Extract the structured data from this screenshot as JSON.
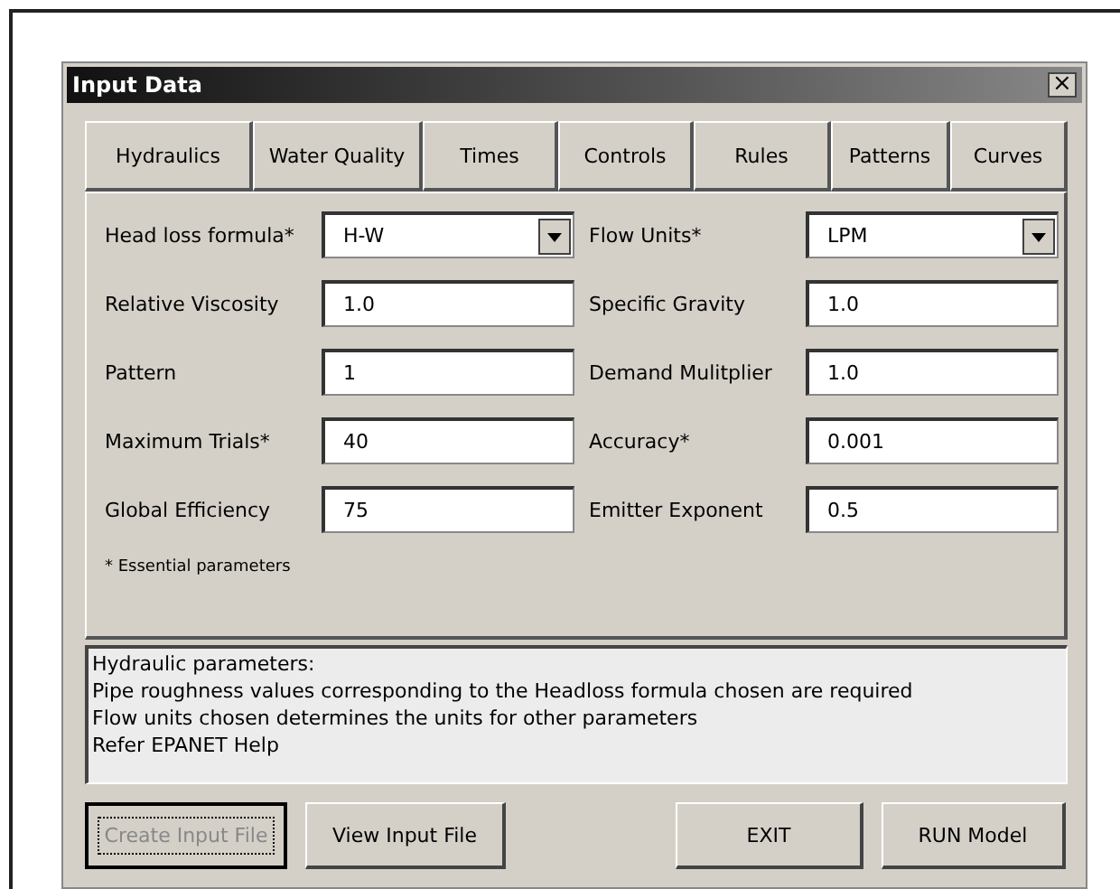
{
  "window": {
    "title": "Input Data",
    "close": "×"
  },
  "tabs": [
    {
      "label": "Hydraulics"
    },
    {
      "label": "Water Quality"
    },
    {
      "label": "Times"
    },
    {
      "label": "Controls"
    },
    {
      "label": "Rules"
    },
    {
      "label": "Patterns"
    },
    {
      "label": "Curves"
    }
  ],
  "fields": [
    {
      "label": "Head loss formula*",
      "value": "H-W",
      "kind": "dropdown"
    },
    {
      "label": "Flow Units*",
      "value": "LPM",
      "kind": "dropdown"
    },
    {
      "label": "Relative Viscosity",
      "value": "1.0",
      "kind": "text"
    },
    {
      "label": "Specific Gravity",
      "value": "1.0",
      "kind": "text"
    },
    {
      "label": "Pattern",
      "value": "1",
      "kind": "text"
    },
    {
      "label": "Demand Mulitplier",
      "value": "1.0",
      "kind": "text"
    },
    {
      "label": "Maximum Trials*",
      "value": "40",
      "kind": "text"
    },
    {
      "label": "Accuracy*",
      "value": "0.001",
      "kind": "text"
    },
    {
      "label": "Global Efficiency",
      "value": "75",
      "kind": "text"
    },
    {
      "label": "Emitter Exponent",
      "value": "0.5",
      "kind": "text"
    }
  ],
  "note": "* Essential parameters",
  "info": [
    "Hydraulic parameters:",
    "Pipe roughness values corresponding to the Headloss formula chosen are required",
    "Flow units chosen determines the units for other parameters",
    "Refer EPANET Help"
  ],
  "buttons": [
    {
      "label": "Create Input File",
      "disabled": true,
      "focused": true
    },
    {
      "label": "View Input File",
      "disabled": false,
      "focused": false
    },
    {
      "label": "EXIT",
      "disabled": false,
      "focused": false
    },
    {
      "label": "RUN Model",
      "disabled": false,
      "focused": false
    }
  ]
}
